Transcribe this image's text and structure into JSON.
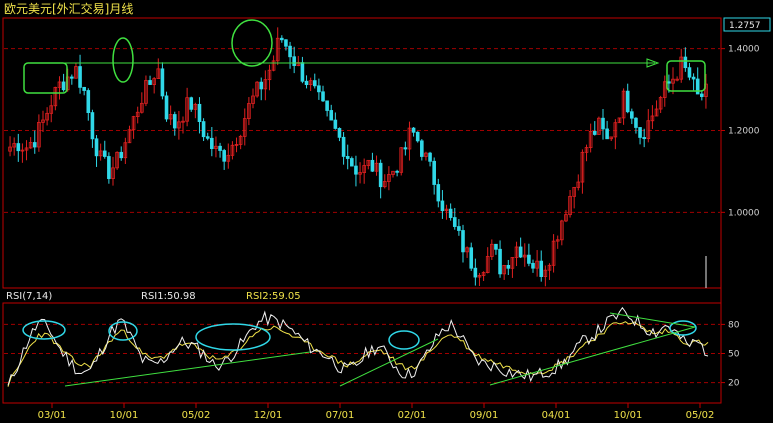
{
  "title": "欧元美元[外汇交易]月线",
  "colors": {
    "background": "#000000",
    "frame": "#c00000",
    "grid": "#a00000",
    "up_candle": "#e02020",
    "down_candle": "#30d8e8",
    "annotation": "#40e040",
    "rsi1_line": "#f0f0f0",
    "rsi2_line": "#f0e24a",
    "circle_cyan": "#30d8e8"
  },
  "price_panel": {
    "y_ticks": [
      "1.4000",
      "1.2000",
      "1.0000"
    ],
    "current_price_label": "1.2757"
  },
  "rsi_panel": {
    "name": "RSI(7,14)",
    "rsi1_label": "RSI1:50.98",
    "rsi2_label": "RSI2:59.05",
    "y_ticks": [
      "80",
      "50",
      "20"
    ]
  },
  "time_axis": {
    "labels": [
      "03/01",
      "10/01",
      "05/02",
      "12/01",
      "07/01",
      "02/01",
      "09/01",
      "04/01",
      "10/01",
      "05/02"
    ]
  },
  "chart_data": {
    "type": "candlestick",
    "title": "欧元美元[外汇交易]月线",
    "price_ylim": [
      0.82,
      1.47
    ],
    "rsi_ylim": [
      0,
      100
    ],
    "x_tick_labels": [
      "03/01",
      "10/01",
      "05/02",
      "12/01",
      "07/01",
      "02/01",
      "09/01",
      "04/01",
      "10/01",
      "05/02"
    ],
    "last_price": 1.2757,
    "rsi1_last": 50.98,
    "rsi2_last": 59.05,
    "close_path": [
      1.16,
      1.17,
      1.16,
      1.18,
      1.22,
      1.27,
      1.31,
      1.33,
      1.35,
      1.3,
      1.2,
      1.13,
      1.1,
      1.12,
      1.17,
      1.22,
      1.28,
      1.31,
      1.36,
      1.25,
      1.21,
      1.24,
      1.27,
      1.23,
      1.18,
      1.15,
      1.14,
      1.16,
      1.2,
      1.25,
      1.29,
      1.32,
      1.36,
      1.43,
      1.4,
      1.36,
      1.33,
      1.3,
      1.26,
      1.22,
      1.19,
      1.15,
      1.11,
      1.1,
      1.12,
      1.09,
      1.08,
      1.11,
      1.14,
      1.2,
      1.17,
      1.12,
      1.07,
      1.01,
      0.97,
      0.93,
      0.89,
      0.86,
      0.88,
      0.91,
      0.86,
      0.89,
      0.92,
      0.9,
      0.87,
      0.86,
      0.9,
      0.96,
      1.02,
      1.07,
      1.14,
      1.19,
      1.21,
      1.17,
      1.23,
      1.28,
      1.25,
      1.19,
      1.22,
      1.26,
      1.3,
      1.33,
      1.36,
      1.33,
      1.28,
      1.29
    ],
    "rsi1_path": [
      15,
      40,
      65,
      82,
      76,
      55,
      42,
      30,
      32,
      52,
      72,
      84,
      66,
      44,
      38,
      42,
      55,
      62,
      58,
      50,
      38,
      40,
      52,
      64,
      80,
      86,
      84,
      78,
      70,
      60,
      52,
      48,
      38,
      32,
      40,
      52,
      58,
      46,
      32,
      28,
      38,
      55,
      72,
      80,
      68,
      48,
      40,
      38,
      34,
      30,
      28,
      26,
      30,
      34,
      40,
      52,
      64,
      70,
      80,
      88,
      92,
      84,
      76,
      72,
      80,
      70,
      58,
      62,
      51
    ],
    "rsi2_path": [
      18,
      35,
      55,
      70,
      68,
      56,
      46,
      38,
      38,
      50,
      64,
      74,
      64,
      50,
      44,
      46,
      54,
      60,
      58,
      52,
      44,
      44,
      52,
      60,
      72,
      76,
      76,
      72,
      66,
      60,
      54,
      50,
      42,
      38,
      42,
      50,
      54,
      48,
      38,
      34,
      40,
      52,
      64,
      70,
      64,
      52,
      46,
      42,
      38,
      34,
      32,
      30,
      32,
      36,
      42,
      50,
      60,
      66,
      74,
      80,
      84,
      80,
      74,
      70,
      74,
      68,
      60,
      62,
      59
    ]
  }
}
